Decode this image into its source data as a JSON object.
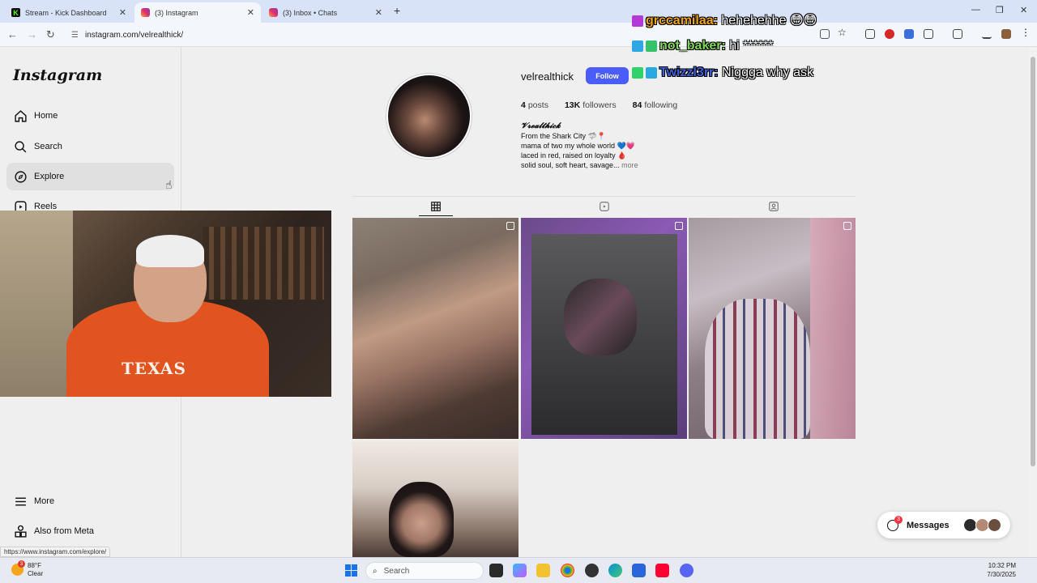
{
  "browser": {
    "tabs": [
      {
        "title": "Stream - Kick Dashboard",
        "active": false,
        "favicon": "kick-icon"
      },
      {
        "title": "(3) Instagram",
        "active": true,
        "favicon": "instagram-icon"
      },
      {
        "title": "(3) Inbox • Chats",
        "active": false,
        "favicon": "instagram-icon"
      }
    ],
    "url": "instagram.com/velrealthick/",
    "status_url": "https://www.instagram.com/explore/"
  },
  "sidebar": {
    "logo": "Instagram",
    "items": [
      {
        "label": "Home",
        "icon": "home-icon"
      },
      {
        "label": "Search",
        "icon": "search-icon"
      },
      {
        "label": "Explore",
        "icon": "compass-icon"
      },
      {
        "label": "Reels",
        "icon": "reels-icon"
      }
    ],
    "bottom_items": [
      {
        "label": "More",
        "icon": "menu-icon"
      },
      {
        "label": "Also from Meta",
        "icon": "meta-apps-icon"
      }
    ]
  },
  "profile": {
    "username": "velrealthick",
    "follow_label": "Follow",
    "posts_count": "4",
    "posts_label": "posts",
    "followers_count": "13K",
    "followers_label": "followers",
    "following_count": "84",
    "following_label": "following",
    "display_name": "𝓥𝓻𝓮𝓪𝓵𝓽𝓱𝓲𝓬𝓴",
    "bio_lines": [
      "From the Shark City 🦈📍",
      "mama of two my whole world 💙💗",
      "laced in red, raised on loyalty 🩸",
      "solid soul, soft heart, savage..."
    ],
    "more_label": "more"
  },
  "profile_tabs": [
    "posts-grid-icon",
    "reels-icon",
    "tagged-icon"
  ],
  "messages": {
    "label": "Messages",
    "badge": "3"
  },
  "chat_overlay": [
    {
      "user": "grccamilaa",
      "message": "hehehehhe 😳😳",
      "user_color": "#f1a21b"
    },
    {
      "user": "not_baker",
      "message": "hi ******",
      "user_color": "#7ed957"
    },
    {
      "user": "Twizzl3rr",
      "message": "Niggga why ask",
      "user_color": "#3d5fd9"
    }
  ],
  "webcam": {
    "shirt_text": "TEXAS"
  },
  "taskbar": {
    "weather_temp": "88°F",
    "weather_desc": "Clear",
    "weather_badge": "3",
    "search_placeholder": "Search",
    "time": "10:32 PM",
    "date": "7/30/2025"
  }
}
